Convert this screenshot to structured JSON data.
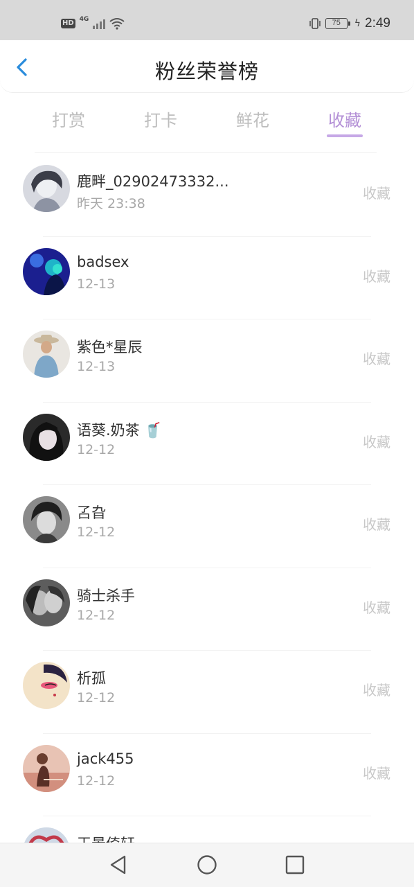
{
  "status_bar": {
    "hd": "HD",
    "network": "4G",
    "battery": "75",
    "time": "2:49"
  },
  "header": {
    "title": "粉丝荣誉榜"
  },
  "tabs": [
    {
      "label": "打赏"
    },
    {
      "label": "打卡"
    },
    {
      "label": "鲜花"
    },
    {
      "label": "收藏"
    }
  ],
  "active_tab": "收藏",
  "list": [
    {
      "name": "鹿畔_02902473332...",
      "date": "昨天 23:38",
      "action": "收藏"
    },
    {
      "name": "badsex",
      "date": "12-13",
      "action": "收藏"
    },
    {
      "name": "紫色*星辰",
      "date": "12-13",
      "action": "收藏"
    },
    {
      "name": "语葵.奶茶",
      "emoji": "🥤",
      "date": "12-12",
      "action": "收藏"
    },
    {
      "name": "叾旮",
      "date": "12-12",
      "action": "收藏"
    },
    {
      "name": "骑士杀手",
      "date": "12-12",
      "action": "收藏"
    },
    {
      "name": "析孤",
      "date": "12-12",
      "action": "收藏"
    },
    {
      "name": "jack455",
      "date": "12-12",
      "action": "收藏"
    },
    {
      "name": "王景倚轩",
      "date": "",
      "action": ""
    }
  ],
  "colors": {
    "accent": "#b38fd6",
    "back_arrow": "#2a8cdc",
    "status_bar_bg": "#d9d9d9",
    "muted_text": "#a8a8a8"
  },
  "icons": {
    "back": "chevron-left-icon",
    "nav_back": "triangle-back-icon",
    "nav_home": "circle-home-icon",
    "nav_recent": "square-recent-icon"
  }
}
